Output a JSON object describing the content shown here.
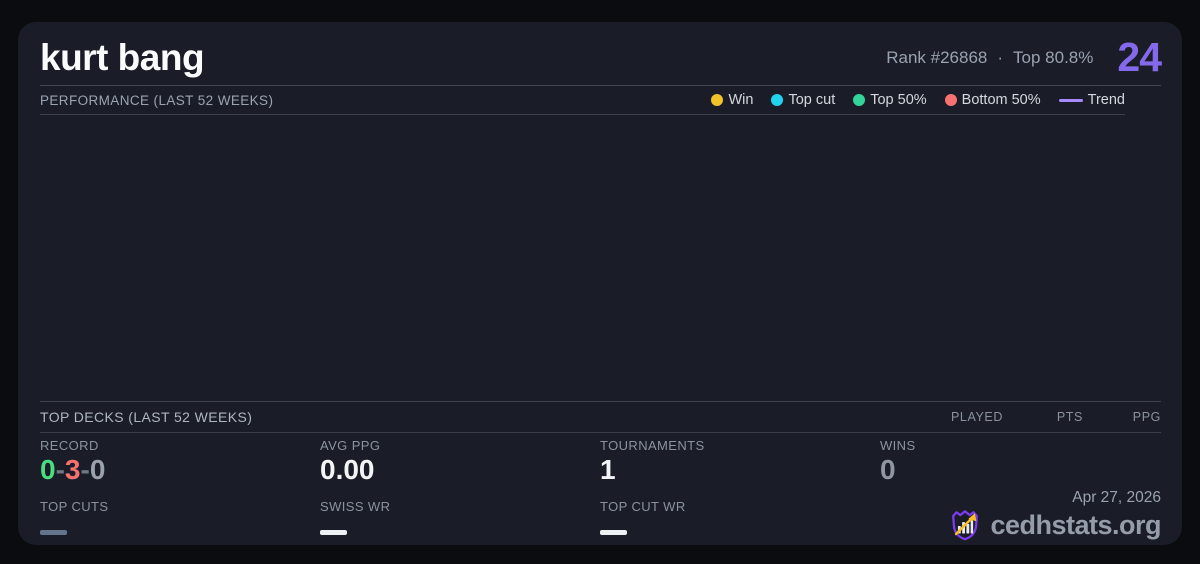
{
  "header": {
    "player_name": "kurt bang",
    "rank": "Rank #26868",
    "separator": "·",
    "top_percent": "Top 80.8%",
    "points": "24",
    "points_color": "#8569ec"
  },
  "performance": {
    "title": "PERFORMANCE (LAST 52 WEEKS)",
    "legend": [
      {
        "label": "Win",
        "color": "#f0c428",
        "swatch": "dot"
      },
      {
        "label": "Top cut",
        "color": "#22d3ee",
        "swatch": "dot"
      },
      {
        "label": "Top 50%",
        "color": "#34d399",
        "swatch": "dot"
      },
      {
        "label": "Bottom 50%",
        "color": "#f87171",
        "swatch": "dot"
      },
      {
        "label": "Trend",
        "color": "#a78bfa",
        "swatch": "line"
      }
    ]
  },
  "chart_data": {
    "type": "scatter",
    "title": "PERFORMANCE (LAST 52 WEEKS)",
    "series": [
      {
        "name": "Win",
        "points": []
      },
      {
        "name": "Top cut",
        "points": []
      },
      {
        "name": "Top 50%",
        "points": []
      },
      {
        "name": "Bottom 50%",
        "points": []
      },
      {
        "name": "Trend",
        "points": []
      }
    ],
    "note": "chart area rendered empty - no plotted data points, axes, or gridlines visible"
  },
  "top_decks": {
    "title": "TOP DECKS (LAST 52 WEEKS)",
    "columns": [
      "PLAYED",
      "PTS",
      "PPG"
    ],
    "rows": []
  },
  "stats": {
    "record": {
      "label": "RECORD",
      "wins": "0",
      "losses": "3",
      "draws": "0",
      "separator": "-",
      "wins_color": "#4ade80",
      "losses_color": "#f87171",
      "draws_color": "#9aa1ad"
    },
    "avg_ppg": {
      "label": "AVG PPG",
      "value": "0.00"
    },
    "tournaments": {
      "label": "TOURNAMENTS",
      "value": "1"
    },
    "wins": {
      "label": "WINS",
      "value": "0"
    },
    "top_cuts": {
      "label": "TOP CUTS",
      "value": "—"
    },
    "swiss_wr": {
      "label": "SWISS WR",
      "value": "—"
    },
    "top_cut_wr": {
      "label": "TOP CUT WR",
      "value": "—"
    }
  },
  "footer": {
    "date": "Apr 27, 2026",
    "brand": "cedhstats.org"
  },
  "colors": {
    "page_bg": "#0b0c10",
    "card_bg": "#1a1d27",
    "accent_purple": "#8569ec",
    "logo_shield": "#7c3aed",
    "logo_arrow": "#fbbf24"
  }
}
